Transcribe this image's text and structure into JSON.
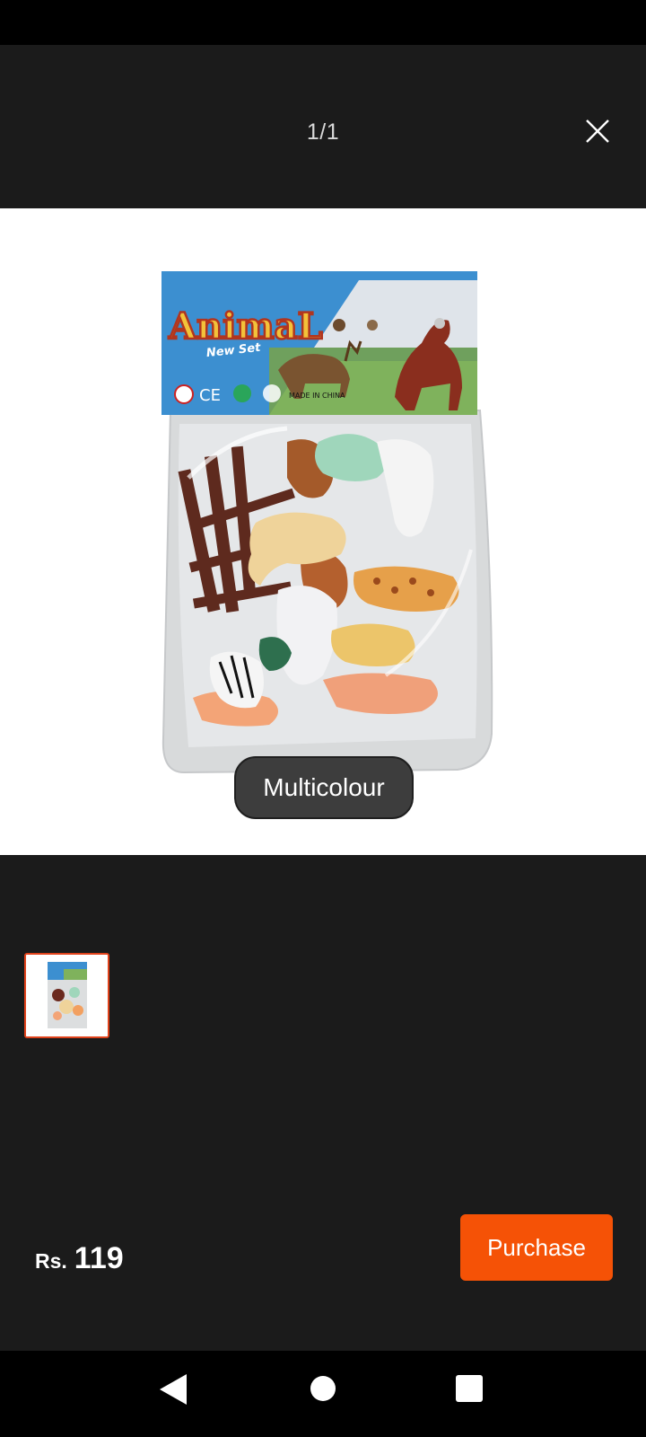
{
  "viewer": {
    "counter": "1/1",
    "close_icon": "close-icon"
  },
  "product": {
    "package_brand": "AnimaL",
    "package_subtitle": "New Set",
    "package_origin": "MADE IN CHINA",
    "package_mark": "CE",
    "variant_label": "Multicolour"
  },
  "footer": {
    "price_currency": "Rs.",
    "price_amount": "119",
    "purchase_label": "Purchase"
  },
  "colors": {
    "accent": "#f55206",
    "thumb_border": "#e0421b",
    "background": "#1b1b1b"
  },
  "nav": {
    "back_icon": "back-triangle-icon",
    "home_icon": "home-circle-icon",
    "recents_icon": "recents-square-icon"
  }
}
